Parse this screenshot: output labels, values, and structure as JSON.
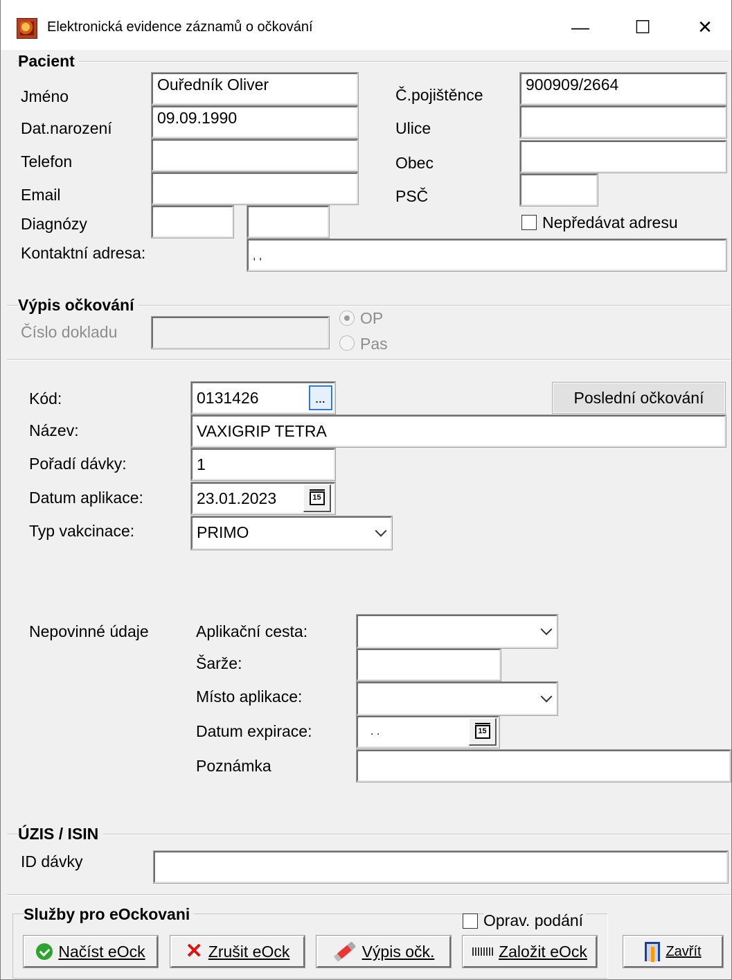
{
  "window": {
    "title": "Elektronická evidence záznamů o očkování",
    "minimize": "—",
    "maximize": "☐",
    "close": "✕"
  },
  "patient": {
    "section_title": "Pacient",
    "labels": {
      "name": "Jméno",
      "birth_date": "Dat.narození",
      "phone": "Telefon",
      "email": "Email",
      "diagnoses": "Diagnózy",
      "contact_address": "Kontaktní adresa:",
      "insurance_no": "Č.pojištěnce",
      "street": "Ulice",
      "city": "Obec",
      "zip": "PSČ"
    },
    "values": {
      "name": "Ouředník Oliver",
      "birth_date": "09.09.1990",
      "phone": "",
      "email": "",
      "diagnosis1": "",
      "diagnosis2": "",
      "contact_address": ", ,",
      "insurance_no": "900909/2664",
      "street": "",
      "city": "",
      "zip": ""
    },
    "no_address_label": "Nepředávat adresu"
  },
  "extract": {
    "section_title": "Výpis očkování",
    "doc_number_label": "Číslo dokladu",
    "doc_number": "",
    "radio_op": "OP",
    "radio_pas": "Pas"
  },
  "vaccine": {
    "labels": {
      "code": "Kód:",
      "name": "Název:",
      "dose_order": "Pořadí dávky:",
      "application_date": "Datum aplikace:",
      "vaccination_type": "Typ vakcinace:"
    },
    "values": {
      "code": "0131426",
      "name": "VAXIGRIP TETRA",
      "dose_order": "1",
      "application_date": "23.01.2023",
      "vaccination_type": "PRIMO"
    },
    "last_vaccination_button": "Poslední očkování",
    "ellipsis": "...",
    "calendar_icon_text": "15"
  },
  "optional": {
    "title": "Nepovinné údaje",
    "labels": {
      "route": "Aplikační cesta:",
      "batch": "Šarže:",
      "site": "Místo aplikace:",
      "expiry": "Datum expirace:",
      "note": "Poznámka"
    },
    "values": {
      "route": "",
      "batch": "",
      "site": "",
      "expiry": ". .",
      "note": ""
    }
  },
  "uzis": {
    "section_title": "ÚZIS / ISIN",
    "dose_id_label": "ID dávky",
    "dose_id": ""
  },
  "services": {
    "section_title": "Služby pro eOckovani",
    "correction_label": "Oprav. podání",
    "buttons": {
      "load": "Načíst eOck",
      "cancel": "Zrušit eOck",
      "extract": "Výpis očk.",
      "create": "Založit eOck",
      "close": "Zavřít"
    }
  }
}
